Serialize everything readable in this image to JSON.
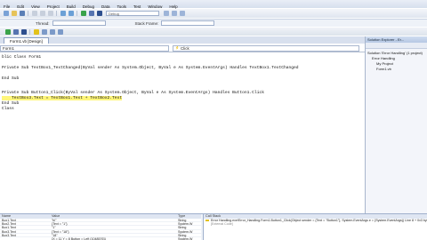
{
  "menu": [
    "File",
    "Edit",
    "View",
    "Project",
    "Build",
    "Debug",
    "Data",
    "Tools",
    "Test",
    "Window",
    "Help"
  ],
  "debug_toolbar": {
    "thread_label": "Thread:",
    "stack_label": "Stack Frame:"
  },
  "toolbar": {
    "combo_text": "Debug"
  },
  "doc_tabs": [
    "Form1.vb [Design]"
  ],
  "nav": {
    "left": "Form1",
    "right": "Click"
  },
  "code_lines": [
    {
      "text": "blic Class Form1",
      "kw": []
    },
    {
      "text": "",
      "kw": []
    },
    {
      "text": "Private Sub TextBox1_TextChanged(ByVal sender As System.Object, ByVal e As System.EventArgs) Handles TextBox1.TextChanged",
      "kw": []
    },
    {
      "text": "",
      "kw": []
    },
    {
      "text": "End Sub",
      "kw": []
    },
    {
      "text": "",
      "kw": []
    },
    {
      "text": "Private Sub Button1_Click(ByVal sender As System.Object, ByVal e As System.EventArgs) Handles Button1.Click",
      "kw": []
    },
    {
      "text": "    TextBox3.Text = TextBox1.Text + TextBox2.Text",
      "highlight": true
    },
    {
      "text": "End Sub",
      "kw": []
    },
    {
      "text": "Class",
      "kw": []
    }
  ],
  "solution_explorer": {
    "title": "Solution Explorer - Er...",
    "items": [
      {
        "label": "Solution 'Error Handling' (1 project)",
        "indent": 0
      },
      {
        "label": "Error Handling",
        "indent": 1
      },
      {
        "label": "My Project",
        "indent": 2
      },
      {
        "label": "Form1.vb",
        "indent": 2
      }
    ]
  },
  "watch": {
    "headers": [
      "Name",
      "Value",
      "Type"
    ],
    "rows": [
      [
        "Box1.Text",
        "\"hi\"",
        "String"
      ],
      [
        "Box2.Text",
        "{Text = \"1\"}",
        "System.W"
      ],
      [
        "Box1.Text",
        "\"1\"",
        "String"
      ],
      [
        "Box3.Text",
        "{Text = \"18\"}",
        "System.W"
      ],
      [
        "Box3.Text",
        "\"18\"",
        "String"
      ],
      [
        "",
        "{X = 11 Y = 8 Button = Left {1048576}}",
        "System.W"
      ],
      [
        "",
        "{Text = \"Button1\"}",
        "Object"
      ]
    ]
  },
  "callstack": {
    "title": "Call Stack",
    "rows": [
      {
        "text": "Error Handling.exe!Error_Handling.Form1.Button1_Click(Object sender = {Text = \"Button1\"}, System.EventArgs e = {System.EventArgs}) Line 8 + 0x3 bytes",
        "current": true
      },
      {
        "text": "[External Code]",
        "current": false
      }
    ]
  }
}
